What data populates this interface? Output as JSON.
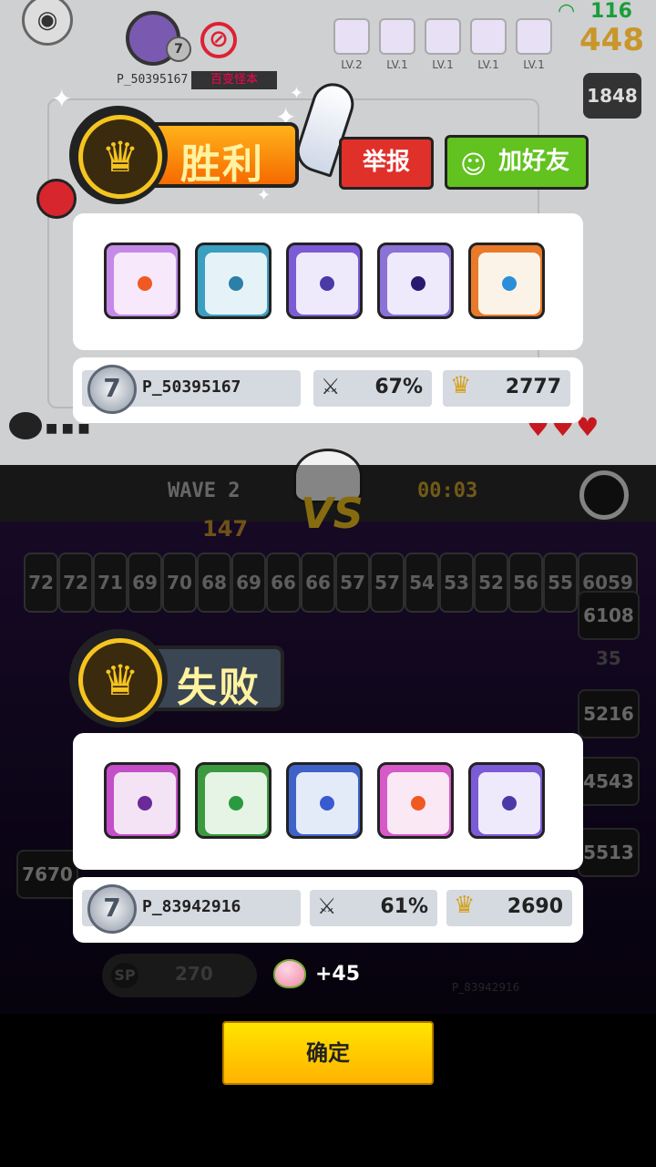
{
  "top_hud": {
    "player_name": "P_50395167",
    "player_tag": "百变怪本",
    "level": "7",
    "deck_levels": [
      "LV.2",
      "LV.1",
      "LV.1",
      "LV.1",
      "LV.1"
    ],
    "ping": "116",
    "gold": "448",
    "side_values": [
      "1848"
    ]
  },
  "winner": {
    "result_label": "胜利",
    "report_button": "举报",
    "add_friend_button": "加好友",
    "player_name": "P_50395167",
    "level": "7",
    "win_rate": "67%",
    "trophies": "2777",
    "cards": [
      {
        "name": "sun-card",
        "frame": "#c58ae8",
        "bg": "#f7e8fb",
        "dot": "#f05a22"
      },
      {
        "name": "vortex-card",
        "frame": "#3b9fc1",
        "bg": "#e5f3f8",
        "dot": "#2b7fa8"
      },
      {
        "name": "eye-card",
        "frame": "#7c5bd6",
        "bg": "#efeafb",
        "dot": "#4a3aa8"
      },
      {
        "name": "lightning-card",
        "frame": "#8a72d6",
        "bg": "#efeafb",
        "dot": "#2a1a6e"
      },
      {
        "name": "infinity-card",
        "frame": "#e87a2a",
        "bg": "#fbf3e8",
        "dot": "#2a8fd8"
      }
    ]
  },
  "battle_bar": {
    "wave": "WAVE 2",
    "vs": "VS",
    "timer": "00:03",
    "gold": "147"
  },
  "grid_numbers": [
    "72",
    "72",
    "71",
    "69",
    "70",
    "68",
    "69",
    "66",
    "66",
    "57",
    "57",
    "54",
    "53",
    "52",
    "56",
    "55",
    "6059"
  ],
  "side_bottom": [
    "6108",
    "35",
    "5216",
    "4543",
    "5513",
    "7670"
  ],
  "loser": {
    "result_label": "失败",
    "player_name": "P_83942916",
    "level": "7",
    "win_rate": "61%",
    "trophies": "2690",
    "cards": [
      {
        "name": "arrow-card",
        "frame": "#c54fc8",
        "bg": "#f4e3f5",
        "dot": "#6a2a9a"
      },
      {
        "name": "wind-card",
        "frame": "#3b9a3e",
        "bg": "#e6f4e6",
        "dot": "#2a9a3e"
      },
      {
        "name": "gear-card",
        "frame": "#3f62c8",
        "bg": "#e4ebf8",
        "dot": "#3a5ad0"
      },
      {
        "name": "sun-card",
        "frame": "#d65ac8",
        "bg": "#fbe8f5",
        "dot": "#f05a22"
      },
      {
        "name": "eye-card",
        "frame": "#7c5bd6",
        "bg": "#efeafb",
        "dot": "#4a3aa8"
      }
    ]
  },
  "footer": {
    "sp_label": "SP",
    "sp_value": "270",
    "reward": "+45",
    "confirm_button": "确定",
    "faint_name": "P_83942916"
  }
}
